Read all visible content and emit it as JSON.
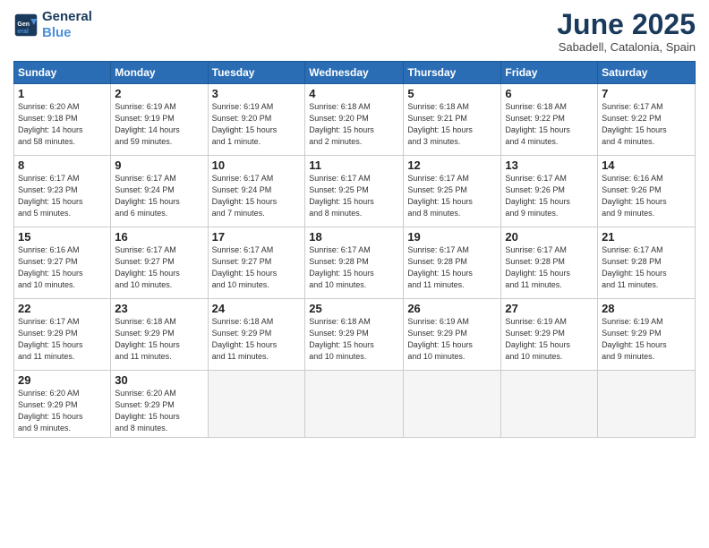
{
  "logo": {
    "line1": "General",
    "line2": "Blue"
  },
  "title": "June 2025",
  "subtitle": "Sabadell, Catalonia, Spain",
  "headers": [
    "Sunday",
    "Monday",
    "Tuesday",
    "Wednesday",
    "Thursday",
    "Friday",
    "Saturday"
  ],
  "weeks": [
    [
      {
        "day": "1",
        "info": "Sunrise: 6:20 AM\nSunset: 9:18 PM\nDaylight: 14 hours\nand 58 minutes."
      },
      {
        "day": "2",
        "info": "Sunrise: 6:19 AM\nSunset: 9:19 PM\nDaylight: 14 hours\nand 59 minutes."
      },
      {
        "day": "3",
        "info": "Sunrise: 6:19 AM\nSunset: 9:20 PM\nDaylight: 15 hours\nand 1 minute."
      },
      {
        "day": "4",
        "info": "Sunrise: 6:18 AM\nSunset: 9:20 PM\nDaylight: 15 hours\nand 2 minutes."
      },
      {
        "day": "5",
        "info": "Sunrise: 6:18 AM\nSunset: 9:21 PM\nDaylight: 15 hours\nand 3 minutes."
      },
      {
        "day": "6",
        "info": "Sunrise: 6:18 AM\nSunset: 9:22 PM\nDaylight: 15 hours\nand 4 minutes."
      },
      {
        "day": "7",
        "info": "Sunrise: 6:17 AM\nSunset: 9:22 PM\nDaylight: 15 hours\nand 4 minutes."
      }
    ],
    [
      {
        "day": "8",
        "info": "Sunrise: 6:17 AM\nSunset: 9:23 PM\nDaylight: 15 hours\nand 5 minutes."
      },
      {
        "day": "9",
        "info": "Sunrise: 6:17 AM\nSunset: 9:24 PM\nDaylight: 15 hours\nand 6 minutes."
      },
      {
        "day": "10",
        "info": "Sunrise: 6:17 AM\nSunset: 9:24 PM\nDaylight: 15 hours\nand 7 minutes."
      },
      {
        "day": "11",
        "info": "Sunrise: 6:17 AM\nSunset: 9:25 PM\nDaylight: 15 hours\nand 8 minutes."
      },
      {
        "day": "12",
        "info": "Sunrise: 6:17 AM\nSunset: 9:25 PM\nDaylight: 15 hours\nand 8 minutes."
      },
      {
        "day": "13",
        "info": "Sunrise: 6:17 AM\nSunset: 9:26 PM\nDaylight: 15 hours\nand 9 minutes."
      },
      {
        "day": "14",
        "info": "Sunrise: 6:16 AM\nSunset: 9:26 PM\nDaylight: 15 hours\nand 9 minutes."
      }
    ],
    [
      {
        "day": "15",
        "info": "Sunrise: 6:16 AM\nSunset: 9:27 PM\nDaylight: 15 hours\nand 10 minutes."
      },
      {
        "day": "16",
        "info": "Sunrise: 6:17 AM\nSunset: 9:27 PM\nDaylight: 15 hours\nand 10 minutes."
      },
      {
        "day": "17",
        "info": "Sunrise: 6:17 AM\nSunset: 9:27 PM\nDaylight: 15 hours\nand 10 minutes."
      },
      {
        "day": "18",
        "info": "Sunrise: 6:17 AM\nSunset: 9:28 PM\nDaylight: 15 hours\nand 10 minutes."
      },
      {
        "day": "19",
        "info": "Sunrise: 6:17 AM\nSunset: 9:28 PM\nDaylight: 15 hours\nand 11 minutes."
      },
      {
        "day": "20",
        "info": "Sunrise: 6:17 AM\nSunset: 9:28 PM\nDaylight: 15 hours\nand 11 minutes."
      },
      {
        "day": "21",
        "info": "Sunrise: 6:17 AM\nSunset: 9:28 PM\nDaylight: 15 hours\nand 11 minutes."
      }
    ],
    [
      {
        "day": "22",
        "info": "Sunrise: 6:17 AM\nSunset: 9:29 PM\nDaylight: 15 hours\nand 11 minutes."
      },
      {
        "day": "23",
        "info": "Sunrise: 6:18 AM\nSunset: 9:29 PM\nDaylight: 15 hours\nand 11 minutes."
      },
      {
        "day": "24",
        "info": "Sunrise: 6:18 AM\nSunset: 9:29 PM\nDaylight: 15 hours\nand 11 minutes."
      },
      {
        "day": "25",
        "info": "Sunrise: 6:18 AM\nSunset: 9:29 PM\nDaylight: 15 hours\nand 10 minutes."
      },
      {
        "day": "26",
        "info": "Sunrise: 6:19 AM\nSunset: 9:29 PM\nDaylight: 15 hours\nand 10 minutes."
      },
      {
        "day": "27",
        "info": "Sunrise: 6:19 AM\nSunset: 9:29 PM\nDaylight: 15 hours\nand 10 minutes."
      },
      {
        "day": "28",
        "info": "Sunrise: 6:19 AM\nSunset: 9:29 PM\nDaylight: 15 hours\nand 9 minutes."
      }
    ],
    [
      {
        "day": "29",
        "info": "Sunrise: 6:20 AM\nSunset: 9:29 PM\nDaylight: 15 hours\nand 9 minutes."
      },
      {
        "day": "30",
        "info": "Sunrise: 6:20 AM\nSunset: 9:29 PM\nDaylight: 15 hours\nand 8 minutes."
      },
      {
        "day": "",
        "info": ""
      },
      {
        "day": "",
        "info": ""
      },
      {
        "day": "",
        "info": ""
      },
      {
        "day": "",
        "info": ""
      },
      {
        "day": "",
        "info": ""
      }
    ]
  ]
}
